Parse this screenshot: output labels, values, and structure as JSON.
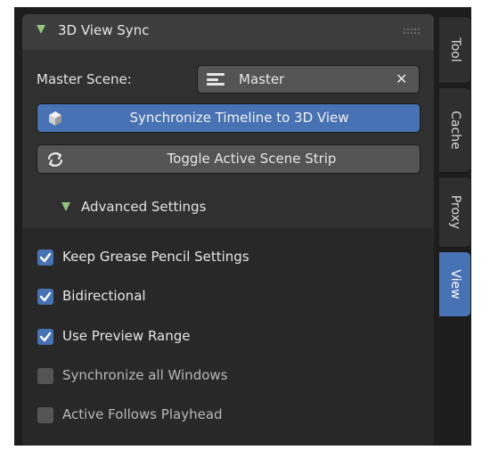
{
  "panel": {
    "title": "3D View Sync",
    "master_scene_label": "Master Scene:",
    "master_scene_value": "Master",
    "sync_button_label": "Synchronize Timeline to 3D View",
    "toggle_button_label": "Toggle Active Scene Strip",
    "advanced_settings_title": "Advanced Settings"
  },
  "options": [
    {
      "label": "Keep Grease Pencil Settings",
      "checked": true
    },
    {
      "label": "Bidirectional",
      "checked": true
    },
    {
      "label": "Use Preview Range",
      "checked": true
    },
    {
      "label": "Synchronize all Windows",
      "checked": false
    },
    {
      "label": "Active Follows Playhead",
      "checked": false
    }
  ],
  "tabs": [
    {
      "label": "Tool",
      "active": false
    },
    {
      "label": "Cache",
      "active": false
    },
    {
      "label": "Proxy",
      "active": false
    },
    {
      "label": "View",
      "active": true
    }
  ],
  "colors": {
    "accent": "#4772b3",
    "expand_arrow": "#93c47d",
    "panel_bg": "#303030",
    "header_bg": "#3d3d3d"
  },
  "icons": {
    "header_expand": "triangle-down-icon",
    "scene": "scene-icon",
    "sync": "cube-icon",
    "toggle": "refresh-icon",
    "clear": "close-icon",
    "grip": "grip-icon"
  }
}
